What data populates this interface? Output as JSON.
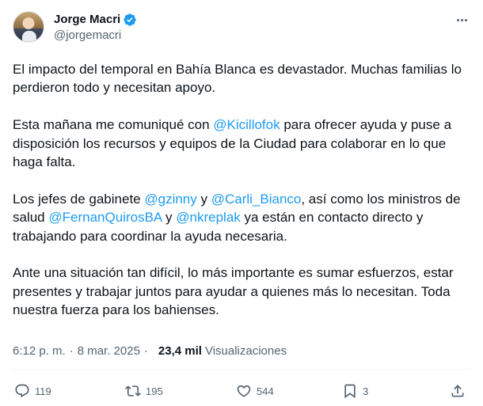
{
  "author": {
    "name": "Jorge Macri",
    "handle": "@jorgemacri"
  },
  "tweet": {
    "paragraphs": [
      [
        {
          "text": "El impacto del temporal en Bahía Blanca es devastador. Muchas familias lo perdieron todo y necesitan apoyo."
        }
      ],
      [
        {
          "text": "Esta mañana me comuniqué con "
        },
        {
          "text": "@Kicillofok",
          "mention": true
        },
        {
          "text": " para ofrecer ayuda y puse a disposición los recursos y equipos de la Ciudad para colaborar en lo que haga falta."
        }
      ],
      [
        {
          "text": "Los jefes de gabinete "
        },
        {
          "text": "@gzinny",
          "mention": true
        },
        {
          "text": " y "
        },
        {
          "text": "@Carli_Bianco",
          "mention": true
        },
        {
          "text": ", así como los ministros de salud "
        },
        {
          "text": "@FernanQuirosBA",
          "mention": true
        },
        {
          "text": " y "
        },
        {
          "text": "@nkreplak",
          "mention": true
        },
        {
          "text": " ya están en contacto directo y trabajando para coordinar la ayuda necesaria."
        }
      ],
      [
        {
          "text": "Ante una situación tan difícil, lo más importante es sumar esfuerzos, estar presentes y trabajar juntos para ayudar a quienes más lo necesitan. Toda nuestra fuerza para los bahienses."
        }
      ]
    ]
  },
  "meta": {
    "time": "6:12 p. m.",
    "separator": "·",
    "date": "8 mar. 2025",
    "views_count": "23,4 mil",
    "views_label": "Visualizaciones"
  },
  "actions": {
    "replies": "119",
    "reposts": "195",
    "likes": "544",
    "bookmarks": "3"
  },
  "colors": {
    "accent": "#1d9bf0",
    "text": "#0f1419",
    "muted": "#536471"
  },
  "icons": [
    "verified-badge-icon",
    "more-icon",
    "reply-icon",
    "repost-icon",
    "like-icon",
    "bookmark-icon",
    "share-icon"
  ]
}
